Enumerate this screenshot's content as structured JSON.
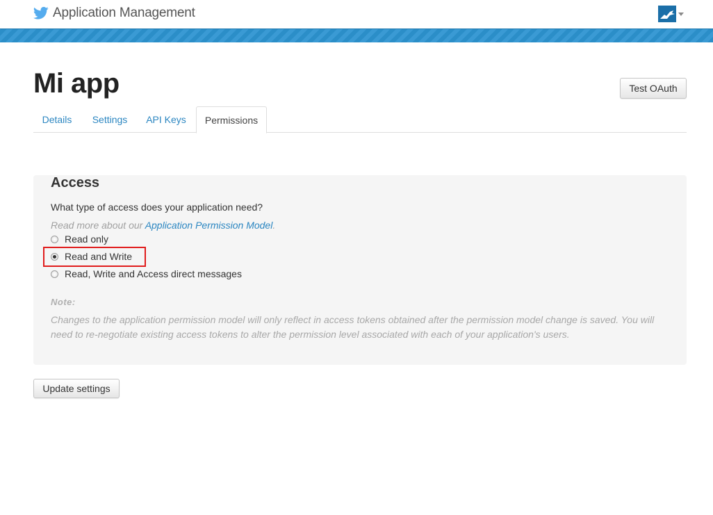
{
  "header": {
    "brand_title": "Application Management",
    "brand_icon": "twitter-bird-icon",
    "accent": "#2b8ec8"
  },
  "page": {
    "title": "Mi app",
    "test_oauth_label": "Test OAuth"
  },
  "tabs": [
    {
      "label": "Details",
      "active": false
    },
    {
      "label": "Settings",
      "active": false
    },
    {
      "label": "API Keys",
      "active": false
    },
    {
      "label": "Permissions",
      "active": true
    }
  ],
  "access": {
    "title": "Access",
    "question": "What type of access does your application need?",
    "read_more_prefix": "Read more about our ",
    "read_more_link": "Application Permission Model",
    "read_more_suffix": ".",
    "options": [
      {
        "label": "Read only",
        "selected": false
      },
      {
        "label": "Read and Write",
        "selected": true
      },
      {
        "label": "Read, Write and Access direct messages",
        "selected": false
      }
    ],
    "highlight_color": "#e01b1b",
    "note_label": "Note:",
    "note_text": "Changes to the application permission model will only reflect in access tokens obtained after the permission model change is saved. You will need to re-negotiate existing access tokens to alter the permission level associated with each of your application's users."
  },
  "footer": {
    "update_label": "Update settings"
  }
}
